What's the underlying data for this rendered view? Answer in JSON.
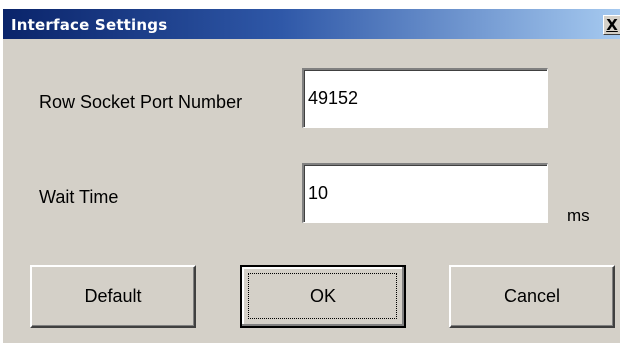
{
  "window": {
    "title": "Interface Settings",
    "close_label": "X"
  },
  "form": {
    "port_label": "Row Socket Port Number",
    "port_value": "49152",
    "wait_label": "Wait Time",
    "wait_value": "10",
    "wait_unit": "ms"
  },
  "buttons": {
    "default_label": "Default",
    "ok_label": "OK",
    "cancel_label": "Cancel"
  },
  "colors": {
    "titlebar_start": "#0a246a",
    "titlebar_end": "#a6caf0",
    "dialog_face": "#d4d0c8"
  }
}
